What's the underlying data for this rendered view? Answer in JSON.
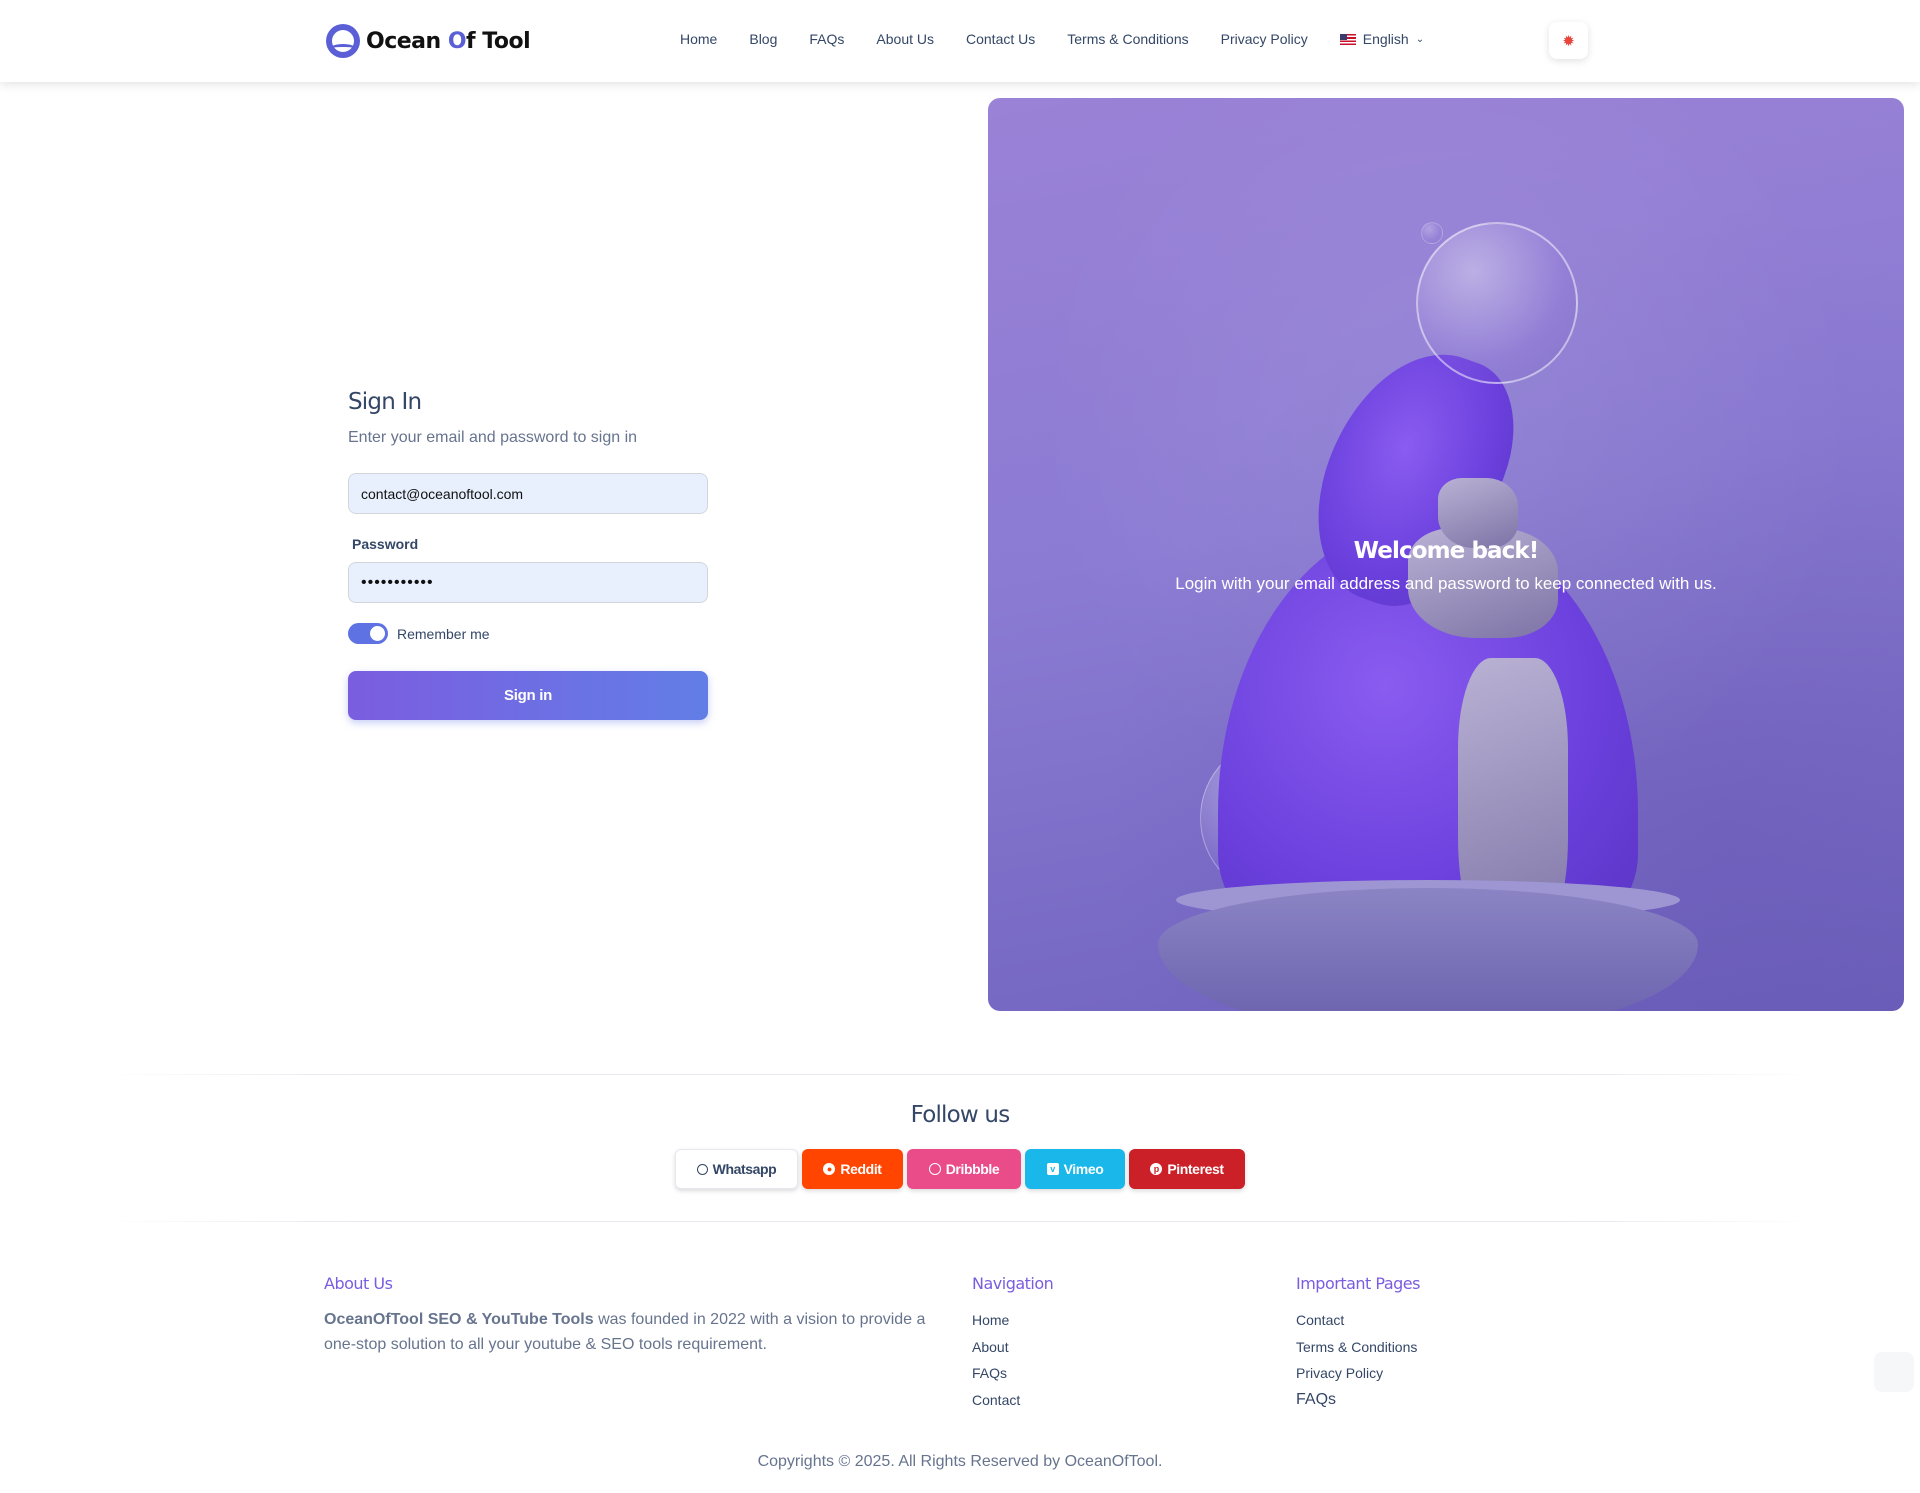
{
  "header": {
    "logo_prefix": "Ocean ",
    "logo_o": "O",
    "logo_suffix": "f Tool",
    "nav": [
      "Home",
      "Blog",
      "FAQs",
      "About Us",
      "Contact Us",
      "Terms & Conditions",
      "Privacy Policy"
    ],
    "language": "English"
  },
  "signin": {
    "title": "Sign In",
    "subtitle": "Enter your email and password to sign in",
    "email_value": "contact@oceanoftool.com",
    "password_label": "Password",
    "password_value": "•••••••••••",
    "remember_label": "Remember me",
    "remember_checked": true,
    "button_label": "Sign in"
  },
  "hero": {
    "title": "Welcome back!",
    "subtitle": "Login with your email address and password to keep connected with us."
  },
  "follow": {
    "title": "Follow us",
    "links": [
      {
        "label": "Whatsapp",
        "icon": "whatsapp-icon",
        "color": "#ffffff"
      },
      {
        "label": "Reddit",
        "icon": "reddit-icon",
        "color": "#ff4500"
      },
      {
        "label": "Dribbble",
        "icon": "dribbble-icon",
        "color": "#ea4c89"
      },
      {
        "label": "Vimeo",
        "icon": "vimeo-icon",
        "color": "#1ab7ea"
      },
      {
        "label": "Pinterest",
        "icon": "pinterest-icon",
        "color": "#cb2027"
      }
    ]
  },
  "footer": {
    "about": {
      "title": "About Us",
      "brand": "OceanOfTool SEO & YouTube Tools",
      "text": " was founded in 2022 with a vision to provide a one-stop solution to all your youtube & SEO tools requirement."
    },
    "navigation": {
      "title": "Navigation",
      "links": [
        "Home",
        "About",
        "FAQs",
        "Contact"
      ]
    },
    "important": {
      "title": "Important Pages",
      "links": [
        "Contact",
        "Terms & Conditions",
        "Privacy Policy",
        "FAQs"
      ]
    },
    "copyright": "Copyrights © 2025. All Rights Reserved by OceanOfTool."
  },
  "colors": {
    "accent": "#7a5ce0",
    "primary_button": "#627ee6"
  }
}
